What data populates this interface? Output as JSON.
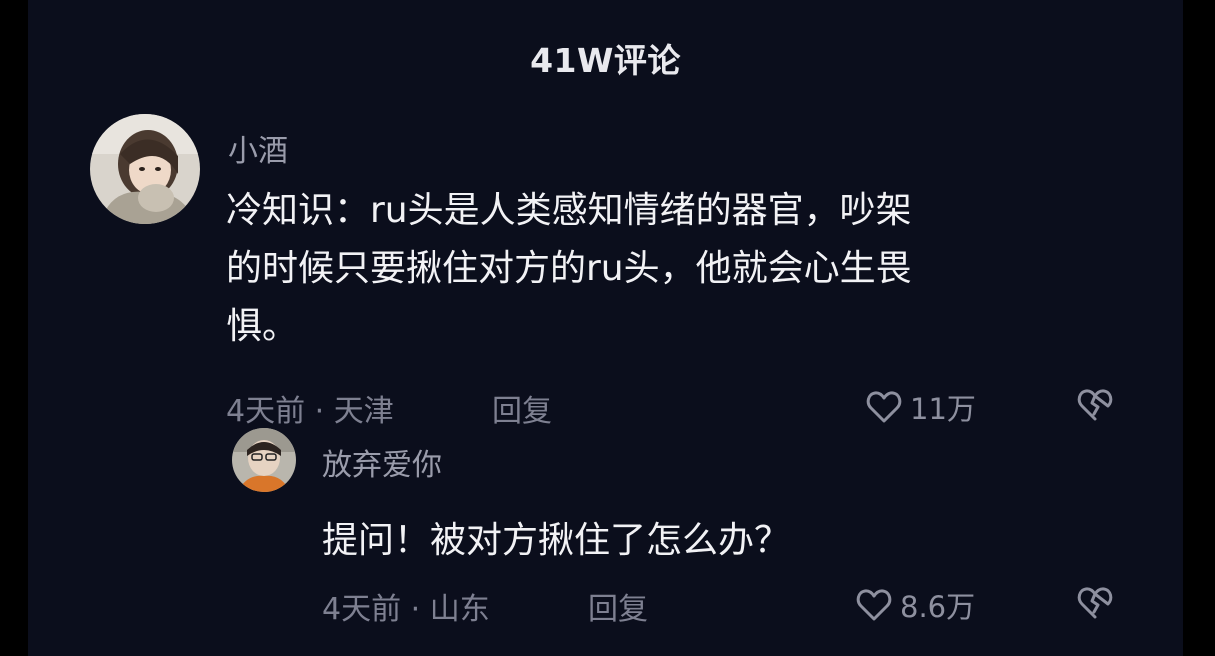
{
  "header": {
    "title": "41W评论"
  },
  "comments": [
    {
      "username": "小酒",
      "line1": "冷知识：ru头是人类感知情绪的器官，吵架",
      "line2": "的时候只要揪住对方的ru头，他就会心生畏",
      "line3": "惧。",
      "meta": "4天前 · 天津",
      "reply_label": "回复",
      "like_count": "11万"
    },
    {
      "username": "放弃爱你",
      "text": "提问！被对方揪住了怎么办？",
      "meta": "4天前 · 山东",
      "reply_label": "回复",
      "like_count": "8.6万"
    }
  ],
  "icons": {
    "like": "heart-outline-icon",
    "dislike": "broken-heart-icon"
  },
  "colors": {
    "background": "#0b0e1c",
    "text": "#f2f2f5",
    "muted": "#7e8091"
  }
}
